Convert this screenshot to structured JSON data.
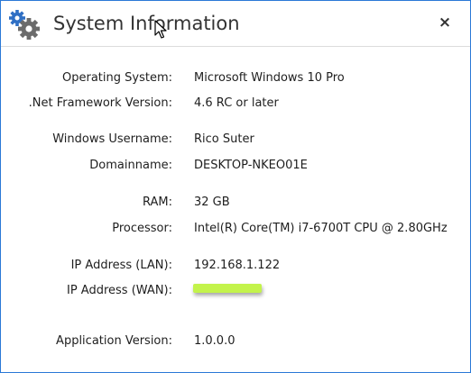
{
  "window": {
    "title": "System Information",
    "close_label": "×",
    "accent_color": "#2b79d7"
  },
  "icons": {
    "app": "gears-icon",
    "close": "close-icon",
    "cursor": "mouse-pointer-icon"
  },
  "rows": [
    {
      "label": "Operating System:",
      "value": "Microsoft Windows 10 Pro"
    },
    {
      "label": ".Net Framework Version:",
      "value": "4.6 RC or later"
    },
    {
      "label": "Windows Username:",
      "value": "Rico Suter"
    },
    {
      "label": "Domainname:",
      "value": "DESKTOP-NKEO01E"
    },
    {
      "label": "RAM:",
      "value": "32 GB"
    },
    {
      "label": "Processor:",
      "value": "Intel(R) Core(TM) i7-6700T CPU @ 2.80GHz"
    },
    {
      "label": "IP Address (LAN):",
      "value": "192.168.1.122"
    },
    {
      "label": "IP Address (WAN):",
      "value": ""
    },
    {
      "label": "Application Version:",
      "value": "1.0.0.0"
    }
  ],
  "redaction": {
    "color": "#c3f34b"
  }
}
